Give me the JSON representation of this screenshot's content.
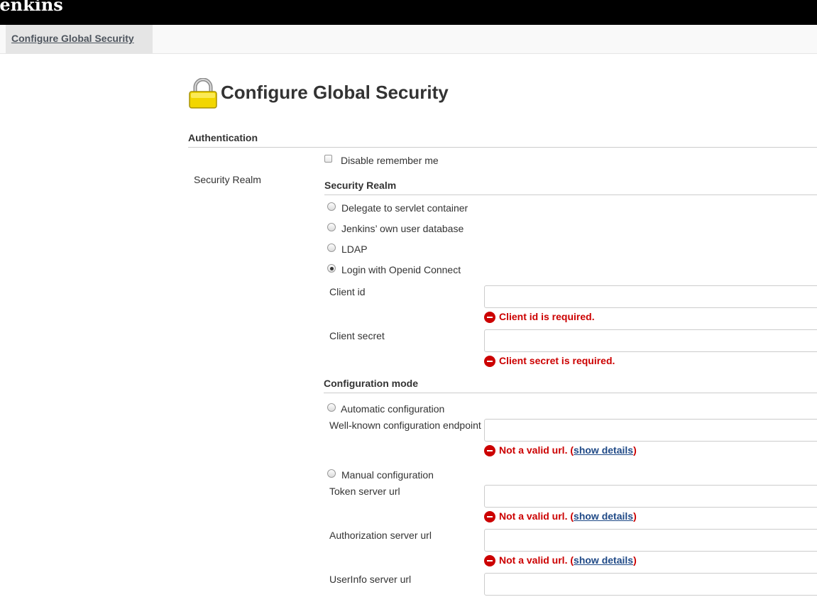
{
  "header": {
    "brand": "Jenkins"
  },
  "breadcrumb": {
    "current": "Configure Global Security"
  },
  "page": {
    "title": "Configure Global Security"
  },
  "authentication": {
    "heading": "Authentication",
    "disable_remember_me": "Disable remember me",
    "security_realm_side_label": "Security Realm"
  },
  "security_realm": {
    "heading": "Security Realm",
    "options": [
      {
        "label": "Delegate to servlet container",
        "selected": false
      },
      {
        "label": "Jenkins’ own user database",
        "selected": false
      },
      {
        "label": "LDAP",
        "selected": false
      },
      {
        "label": "Login with Openid Connect",
        "selected": true
      }
    ]
  },
  "oidc": {
    "client_id": {
      "label": "Client id",
      "value": "",
      "error": "Client id is required."
    },
    "client_secret": {
      "label": "Client secret",
      "value": "",
      "error": "Client secret is required."
    }
  },
  "config_mode": {
    "heading": "Configuration mode",
    "automatic": {
      "label": "Automatic configuration",
      "well_known": {
        "label": "Well-known configuration endpoint",
        "value": "",
        "error": "Not a valid url.",
        "details": "show details"
      }
    },
    "manual": {
      "label": "Manual configuration",
      "token_url": {
        "label": "Token server url",
        "value": "",
        "error": "Not a valid url.",
        "details": "show details"
      },
      "auth_url": {
        "label": "Authorization server url",
        "value": "",
        "error": "Not a valid url.",
        "details": "show details"
      },
      "userinfo_url": {
        "label": "UserInfo server url",
        "value": ""
      }
    }
  },
  "colors": {
    "error": "#cc0000",
    "link": "#204a87",
    "topbar": "#000000",
    "lock": "#f2d600"
  }
}
